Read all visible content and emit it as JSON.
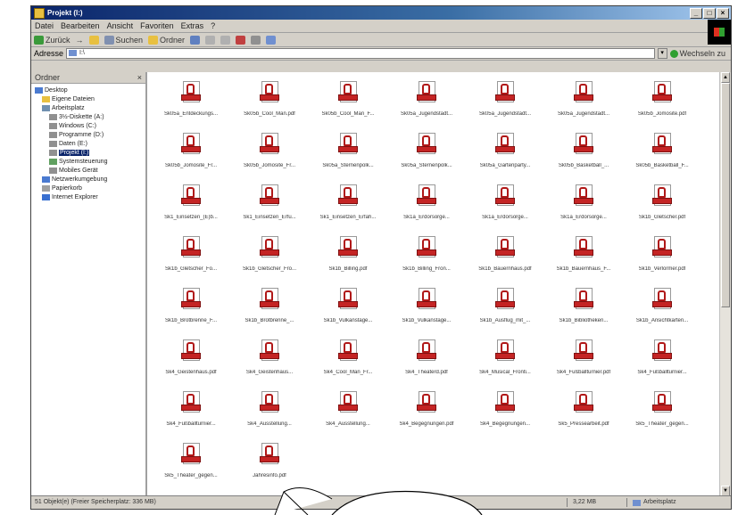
{
  "window": {
    "title": "Projekt (I:)",
    "controls": [
      "_",
      "□",
      "×"
    ]
  },
  "menu": [
    "Datei",
    "Bearbeiten",
    "Ansicht",
    "Favoriten",
    "Extras",
    "?"
  ],
  "toolbar": {
    "back": "Zurück",
    "forward": "→",
    "up": "",
    "search": "Suchen",
    "folders": "Ordner"
  },
  "address": {
    "label": "Adresse",
    "value": "I:\\",
    "go": "Wechseln zu"
  },
  "sidebar": {
    "title": "Ordner",
    "close": "×",
    "tree": [
      {
        "label": "Desktop",
        "indent": 0,
        "color": "#4a7ad0"
      },
      {
        "label": "Eigene Dateien",
        "indent": 1,
        "color": "#e8c040"
      },
      {
        "label": "Arbeitsplatz",
        "indent": 1,
        "color": "#7090b0"
      },
      {
        "label": "3½-Diskette (A:)",
        "indent": 2,
        "color": "#909090"
      },
      {
        "label": "Windows (C:)",
        "indent": 2,
        "color": "#909090"
      },
      {
        "label": "Programme (D:)",
        "indent": 2,
        "color": "#909090"
      },
      {
        "label": "Daten (E:)",
        "indent": 2,
        "color": "#909090"
      },
      {
        "label": "Projekt (I:)",
        "indent": 2,
        "color": "#909090",
        "selected": true
      },
      {
        "label": "Systemsteuerung",
        "indent": 2,
        "color": "#60a060"
      },
      {
        "label": "Mobiles Gerät",
        "indent": 2,
        "color": "#909090"
      },
      {
        "label": "Netzwerkumgebung",
        "indent": 1,
        "color": "#4a7ad0"
      },
      {
        "label": "Papierkorb",
        "indent": 1,
        "color": "#a0a0a0"
      },
      {
        "label": "Internet Explorer",
        "indent": 1,
        "color": "#3a70d0"
      }
    ]
  },
  "files": [
    "Sk05a_Entdeckungs...",
    "Sk05b_Cool_Man.pdf",
    "Sk05b_Cool_Man_F...",
    "Sk05a_Jugendstadt...",
    "Sk05a_Jugendstadt...",
    "Sk05a_Jugendstadt...",
    "Sk05b_Jomosite.pdf",
    "Sk05b_Jomosite_Fr...",
    "Sk05b_Jomosite_Fr...",
    "Sk05a_Sternenpolk...",
    "Sk05a_Sternenpolk...",
    "Sk05a_Gartenparty...",
    "Sk05b_Basketball_...",
    "Sk05b_Basketball_F...",
    "Sk1_Einsetzen_(E)b...",
    "Sk1_Einsetzen_Erfu...",
    "Sk1_Einsetzen_Erfah...",
    "Sk1a_Erdorsorge...",
    "Sk1a_Erdorsorge...",
    "Sk1a_Erdorsorge...",
    "Sk1b_Gletscher.pdf",
    "Sk1b_Gletscher_Fo...",
    "Sk1b_Gletscher_Fro...",
    "Sk1b_Billing.pdf",
    "Sk1b_Billing_Fron...",
    "Sk1b_Bauernhaus.pdf",
    "Sk1b_Bauernhaus_F...",
    "Sk1b_Verlormer.pdf",
    "Sk1b_Brotbrenne_F...",
    "Sk1b_Brotbrenne_...",
    "Sk1b_Vulkanstage...",
    "Sk1b_Vulkanstage...",
    "Sk1b_Ausflug_mit_...",
    "Sk1b_Bibliotheken...",
    "Sk1b_Ansichtkarten...",
    "Sk4_Geistenhaus.pdf",
    "Sk4_Geistenhaus...",
    "Sk4_Cool_Man_Fr...",
    "Sk4_Theaterd.pdf",
    "Sk4_Musical_Fronti...",
    "Sk4_Fußballturnier.pdf",
    "Sk4_Fußballturnier...",
    "Sk4_Fußballturnier...",
    "Sk4_Ausstellung...",
    "Sk4_Ausstellung...",
    "Sk4_Begegnungen.pdf",
    "Sk4_Begegnungen...",
    "Sk5_Pressearbeit.pdf",
    "Sk5_Theater_gegen...",
    "Sk5_Theater_gegen...",
    "Jahresinfo.pdf"
  ],
  "status": {
    "objects": "51 Objekt(e) (Freier Speicherplatz: 336 MB)",
    "size": "3,22 MB",
    "location": "Arbeitsplatz"
  }
}
